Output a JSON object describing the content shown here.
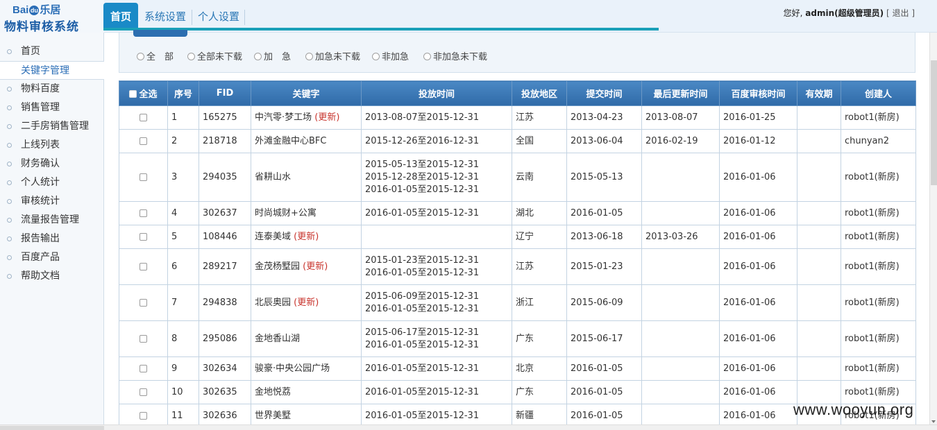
{
  "brand": {
    "logo_prefix": "Bai",
    "logo_du": "du",
    "logo_suffix": "乐居",
    "system_name": "物料审核系统"
  },
  "nav": {
    "tabs": [
      {
        "label": "首页",
        "active": true
      },
      {
        "label": "系统设置",
        "active": false
      },
      {
        "label": "个人设置",
        "active": false
      }
    ]
  },
  "user": {
    "greeting": "您好, ",
    "name": "admin(超级管理员)",
    "bracket_open": "[",
    "logout_label": "退出",
    "bracket_close": "]"
  },
  "sidebar": {
    "items": [
      {
        "label": "首页",
        "active": false
      },
      {
        "label": "关键字管理",
        "active": true
      },
      {
        "label": "物料百度",
        "active": false
      },
      {
        "label": "销售管理",
        "active": false
      },
      {
        "label": "二手房销售管理",
        "active": false
      },
      {
        "label": "上线列表",
        "active": false
      },
      {
        "label": "财务确认",
        "active": false
      },
      {
        "label": "个人统计",
        "active": false
      },
      {
        "label": "审核统计",
        "active": false
      },
      {
        "label": "流量报告管理",
        "active": false
      },
      {
        "label": "报告输出",
        "active": false
      },
      {
        "label": "百度产品",
        "active": false
      },
      {
        "label": "帮助文档",
        "active": false
      }
    ]
  },
  "filter": {
    "options": [
      "全　部",
      "全部未下载",
      "加　急",
      "加急未下载",
      "非加急",
      "非加急未下载"
    ]
  },
  "table": {
    "select_all": "全选",
    "columns": [
      "序号",
      "FID",
      "关键字",
      "投放时间",
      "投放地区",
      "提交时间",
      "最后更新时间",
      "百度审核时间",
      "有效期",
      "创建人"
    ],
    "update_tag": "(更新)",
    "rows": [
      {
        "no": "1",
        "fid": "165275",
        "keyword": "中汽零·梦工场",
        "updated": true,
        "times": [
          "2013-08-07至2015-12-31"
        ],
        "region": "江苏",
        "submit": "2013-04-23",
        "last": "2013-08-07",
        "audit": "2016-01-25",
        "valid": "",
        "creator": "robot1(新房)"
      },
      {
        "no": "2",
        "fid": "218718",
        "keyword": "外滩金融中心BFC",
        "updated": false,
        "times": [
          "2015-12-26至2016-12-31"
        ],
        "region": "全国",
        "submit": "2013-06-04",
        "last": "2016-02-19",
        "audit": "2016-01-12",
        "valid": "",
        "creator": "chunyan2"
      },
      {
        "no": "3",
        "fid": "294035",
        "keyword": "省耕山水",
        "updated": false,
        "times": [
          "2015-05-13至2015-12-31",
          "2015-12-28至2015-12-31",
          "2016-01-05至2015-12-31"
        ],
        "region": "云南",
        "submit": "2015-05-13",
        "last": "",
        "audit": "2016-01-06",
        "valid": "",
        "creator": "robot1(新房)"
      },
      {
        "no": "4",
        "fid": "302637",
        "keyword": "时尚城财+公寓",
        "updated": false,
        "times": [
          "2016-01-05至2015-12-31"
        ],
        "region": "湖北",
        "submit": "2016-01-05",
        "last": "",
        "audit": "2016-01-06",
        "valid": "",
        "creator": "robot1(新房)"
      },
      {
        "no": "5",
        "fid": "108446",
        "keyword": "连泰美域",
        "updated": true,
        "times": [],
        "region": "辽宁",
        "submit": "2013-06-18",
        "last": "2013-03-26",
        "audit": "2016-01-06",
        "valid": "",
        "creator": "robot1(新房)"
      },
      {
        "no": "6",
        "fid": "289217",
        "keyword": "金茂杨墅园",
        "updated": true,
        "times": [
          "2015-01-23至2015-12-31",
          "2016-01-05至2015-12-31"
        ],
        "region": "江苏",
        "submit": "2015-01-23",
        "last": "",
        "audit": "2016-01-06",
        "valid": "",
        "creator": "robot1(新房)"
      },
      {
        "no": "7",
        "fid": "294838",
        "keyword": "北辰奥园",
        "updated": true,
        "times": [
          "2015-06-09至2015-12-31",
          "2016-01-05至2015-12-31"
        ],
        "region": "浙江",
        "submit": "2015-06-09",
        "last": "",
        "audit": "2016-01-06",
        "valid": "",
        "creator": "robot1(新房)"
      },
      {
        "no": "8",
        "fid": "295086",
        "keyword": "金地香山湖",
        "updated": false,
        "times": [
          "2015-06-17至2015-12-31",
          "2016-01-05至2015-12-31"
        ],
        "region": "广东",
        "submit": "2015-06-17",
        "last": "",
        "audit": "2016-01-06",
        "valid": "",
        "creator": "robot1(新房)"
      },
      {
        "no": "9",
        "fid": "302634",
        "keyword": "骏豪·中央公园广场",
        "updated": false,
        "times": [
          "2016-01-05至2015-12-31"
        ],
        "region": "北京",
        "submit": "2016-01-05",
        "last": "",
        "audit": "2016-01-06",
        "valid": "",
        "creator": "robot1(新房)"
      },
      {
        "no": "10",
        "fid": "302635",
        "keyword": "金地悦荔",
        "updated": false,
        "times": [
          "2016-01-05至2015-12-31"
        ],
        "region": "广东",
        "submit": "2016-01-05",
        "last": "",
        "audit": "2016-01-06",
        "valid": "",
        "creator": "robot1(新房)"
      },
      {
        "no": "11",
        "fid": "302636",
        "keyword": "世界美墅",
        "updated": false,
        "times": [
          "2016-01-05至2015-12-31"
        ],
        "region": "新疆",
        "submit": "2016-01-05",
        "last": "",
        "audit": "2016-01-06",
        "valid": "",
        "creator": "robot1(新房)"
      }
    ]
  },
  "watermark": "www.wooyun.org"
}
